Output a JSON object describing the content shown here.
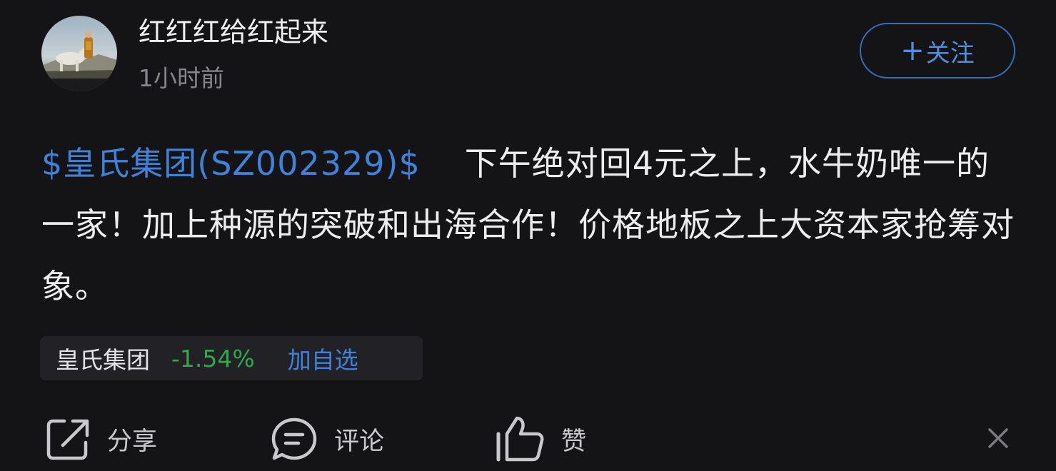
{
  "post": {
    "author_name": "红红红给红起来",
    "time": "1小时前",
    "follow_label": "关注",
    "follow_plus": "+",
    "stock_link": "$皇氏集团(SZ002329)$",
    "content_text": "下午绝对回4元之上，水牛奶唯一的一家！加上种源的突破和出海合作！价格地板之上大资本家抢筹对象。"
  },
  "stock_chip": {
    "name": "皇氏集团",
    "change": "-1.54%",
    "add_label": "加自选"
  },
  "actions": {
    "share_label": "分享",
    "comment_label": "评论",
    "like_label": "赞"
  },
  "icons": {
    "share": "share-icon",
    "comment": "comment-icon",
    "like": "thumbs-up-icon",
    "close": "close-icon"
  },
  "colors": {
    "background": "#141416",
    "link_blue": "#3f82d9",
    "follow_border": "#2f6fbf",
    "change_green": "#2fa84a",
    "chip_bg": "#222226",
    "muted_text": "#86868c"
  }
}
